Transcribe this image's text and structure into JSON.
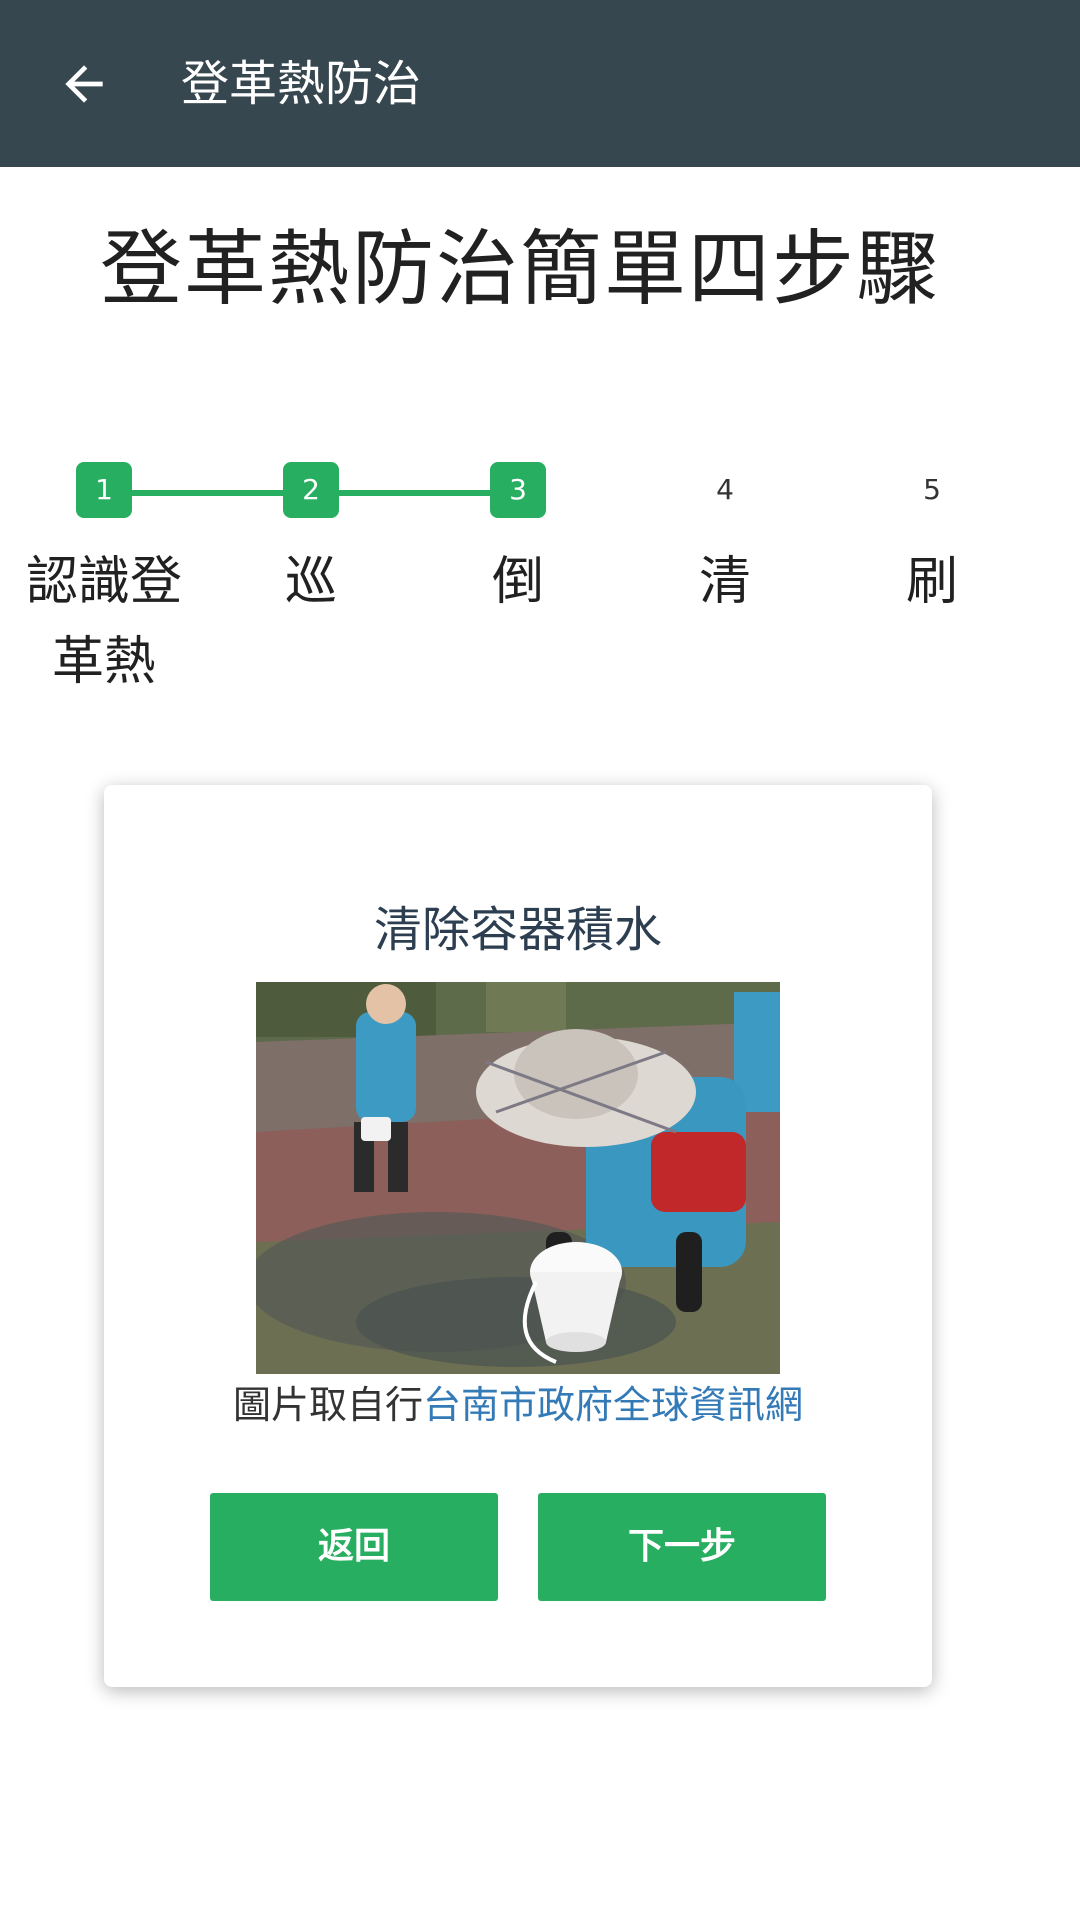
{
  "appbar": {
    "title": "登革熱防治",
    "back_icon": "arrow-left-icon"
  },
  "page": {
    "heading": "登革熱防治簡單四步驟"
  },
  "stepper": {
    "steps": [
      {
        "number": "1",
        "label": "認識登革熱",
        "active": true
      },
      {
        "number": "2",
        "label": "巡",
        "active": true
      },
      {
        "number": "3",
        "label": "倒",
        "active": true
      },
      {
        "number": "4",
        "label": "清",
        "active": false
      },
      {
        "number": "5",
        "label": "刷",
        "active": false
      }
    ],
    "active_color": "#27ae60"
  },
  "card": {
    "title": "清除容器積水",
    "credit_prefix": "圖片取自行",
    "credit_link": "台南市政府全球資訊網",
    "back_button": "返回",
    "next_button": "下一步"
  },
  "colors": {
    "appbar": "#37474f",
    "accent": "#27ae60",
    "link": "#337ab7"
  }
}
